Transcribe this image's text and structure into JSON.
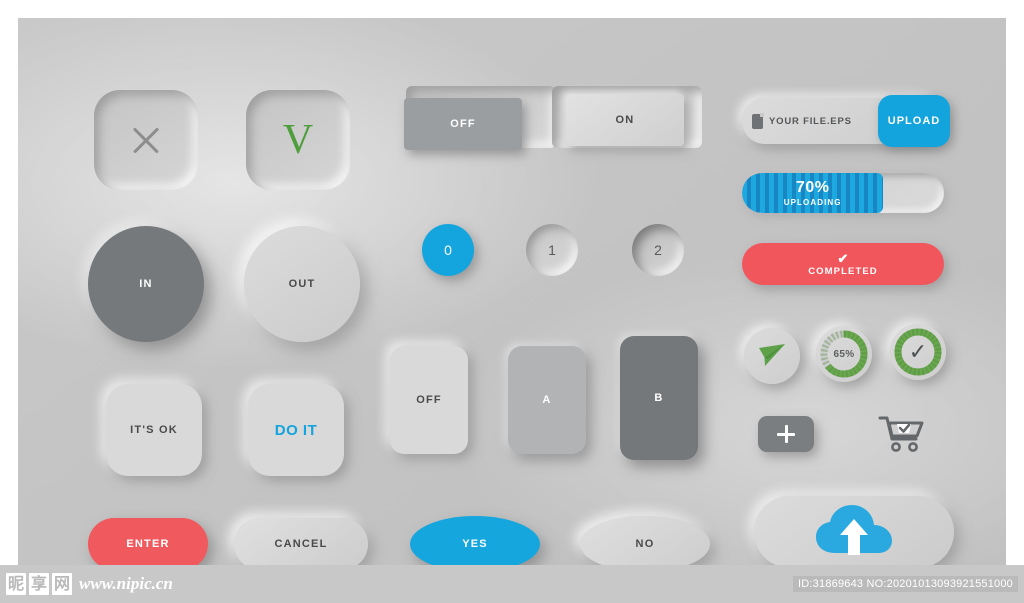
{
  "canvas": {
    "background_color": "#c6c6c6",
    "accent_blue": "#15a5de",
    "accent_red": "#f05a5e",
    "accent_green": "#5aa544",
    "dark_gray": "#76797c"
  },
  "icon_squares": [
    {
      "name": "close",
      "glyph": "x-icon",
      "color": "#8d8d8d"
    },
    {
      "name": "confirm",
      "glyph": "v-check-icon",
      "label": "V",
      "color": "#4f9e3c"
    }
  ],
  "toggles": {
    "off": {
      "label": "OFF",
      "active": true
    },
    "on": {
      "label": "ON",
      "active": false
    }
  },
  "direction_circles": {
    "in": {
      "label": "IN",
      "active": true
    },
    "out": {
      "label": "OUT",
      "active": false
    }
  },
  "number_circles": [
    {
      "label": "0",
      "active": true
    },
    {
      "label": "1",
      "active": false
    },
    {
      "label": "2",
      "active": false
    }
  ],
  "square_buttons": {
    "ok": {
      "label": "IT'S OK"
    },
    "do": {
      "label": "DO IT"
    }
  },
  "vertical_buttons": [
    {
      "label": "OFF",
      "state": "inactive"
    },
    {
      "label": "A",
      "state": "mid"
    },
    {
      "label": "B",
      "state": "active"
    }
  ],
  "pills": {
    "enter": {
      "label": "ENTER"
    },
    "cancel": {
      "label": "CANCEL"
    }
  },
  "ellipses": {
    "yes": {
      "label": "YES"
    },
    "no": {
      "label": "NO"
    }
  },
  "file_upload": {
    "file_icon": "file-icon",
    "file_name": "YOUR FILE.EPS",
    "button_label": "UPLOAD"
  },
  "progress": {
    "percent_label": "70%",
    "state_label": "UPLOADING",
    "percent_value": 70
  },
  "completed": {
    "check_glyph": "✔",
    "label": "COMPLETED"
  },
  "status_circles": [
    {
      "name": "send",
      "icon": "paper-plane-icon",
      "value": null
    },
    {
      "name": "progress-ring",
      "icon": "progress-ring-icon",
      "value": 65,
      "label": "65%"
    },
    {
      "name": "done-ring",
      "icon": "check-ring-icon",
      "value": 100,
      "check_glyph": "✓"
    }
  ],
  "action_buttons": {
    "plus": {
      "icon": "plus-icon",
      "label": "+"
    },
    "cart": {
      "icon": "cart-check-icon"
    }
  },
  "cloud": {
    "icon": "cloud-upload-icon"
  },
  "watermark": {
    "cjk_chars": [
      "昵",
      "享",
      "网"
    ],
    "url": "www.nipic.cn",
    "id_text": "ID:31869643 NO:20201013093921551000"
  }
}
